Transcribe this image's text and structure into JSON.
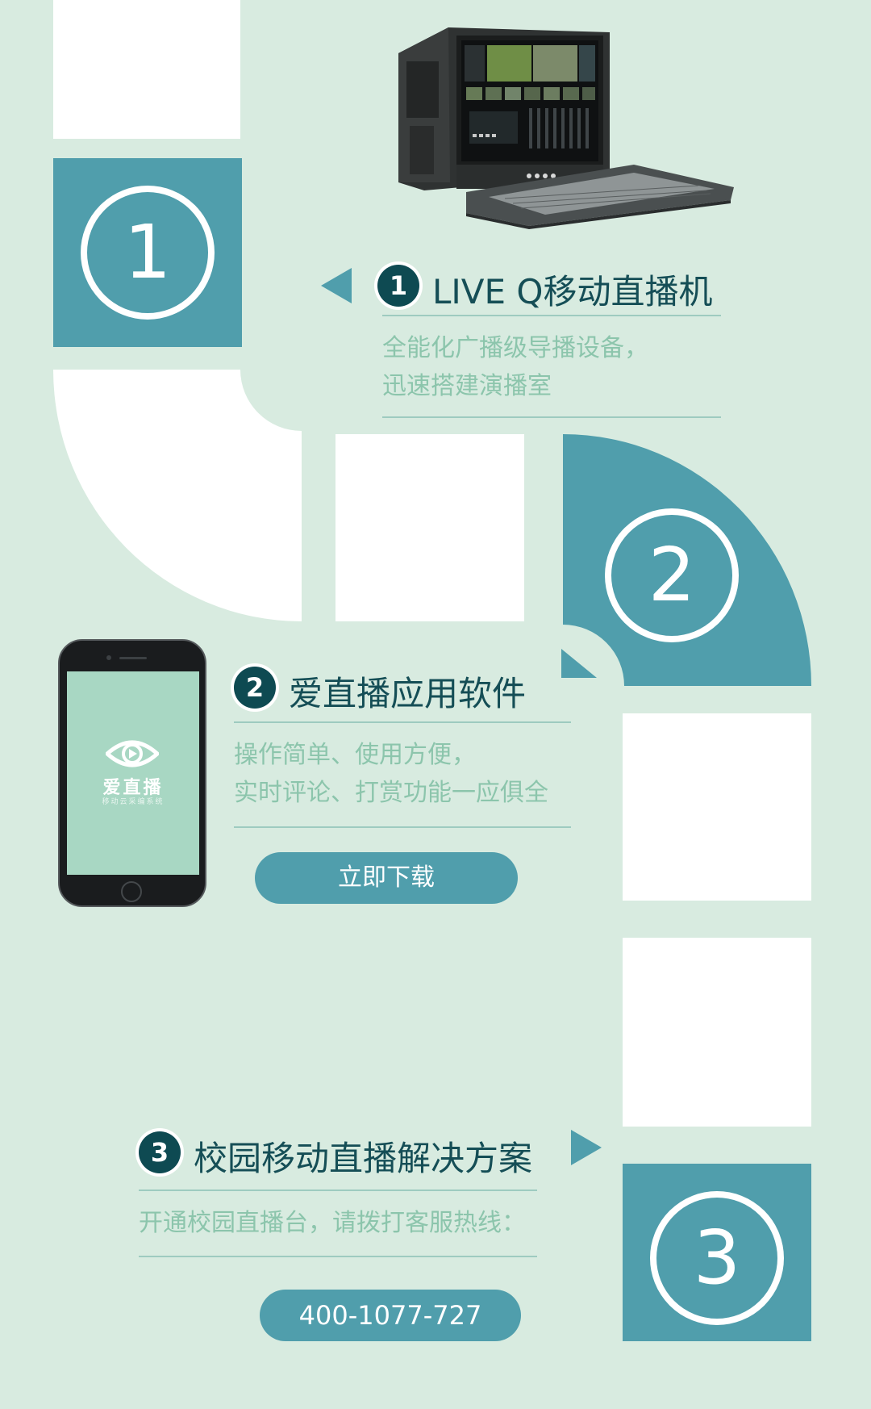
{
  "step1": {
    "marker": "1",
    "title": "LIVE Q移动直播机",
    "desc_lines": [
      "全能化广播级导播设备，",
      "迅速搭建演播室"
    ]
  },
  "step2": {
    "marker": "2",
    "title": "爱直播应用软件",
    "desc_lines": [
      "操作简单、使用方便，",
      "实时评论、打赏功能一应俱全"
    ],
    "button": "立即下载",
    "app": {
      "name": "爱直播",
      "tagline": "移动云采编系统"
    }
  },
  "step3": {
    "marker": "3",
    "title": "校园移动直播解决方案",
    "desc": "开通校园直播台，请拨打客服热线：",
    "phone": "400-1077-727"
  },
  "colors": {
    "background": "#d8ebe0",
    "teal": "#509eac",
    "dark_teal": "#0e4a52",
    "desc_text": "#8cc5ac"
  }
}
